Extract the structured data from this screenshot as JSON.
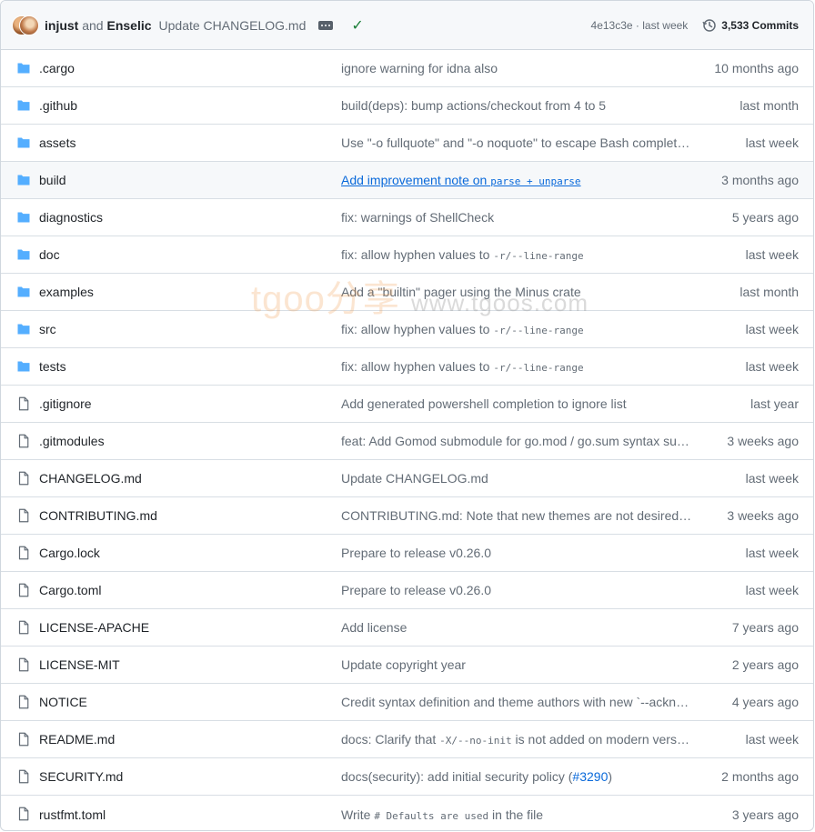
{
  "header": {
    "author1": "injust",
    "author_sep": "and",
    "author2": "Enselic",
    "commit_message": "Update CHANGELOG.md",
    "sha": "4e13c3e",
    "sha_sep": "·",
    "commit_age": "last week",
    "commits_count": "3,533 Commits"
  },
  "watermark": {
    "text": "tgoo分享",
    "url": "www.tgoos.com"
  },
  "colors": {
    "folder": "#54aeff",
    "file": "#636c76",
    "check": "#1a7f37",
    "link": "#0969da"
  },
  "files": [
    {
      "type": "folder",
      "name": ".cargo",
      "msg_parts": [
        {
          "t": "ignore warning for idna also"
        }
      ],
      "age": "10 months ago"
    },
    {
      "type": "folder",
      "name": ".github",
      "msg_parts": [
        {
          "t": "build(deps): bump actions/checkout from 4 to 5"
        }
      ],
      "age": "last month"
    },
    {
      "type": "folder",
      "name": "assets",
      "msg_parts": [
        {
          "t": "Use \"-o fullquote\" and \"-o noquote\" to escape Bash completion"
        }
      ],
      "age": "last week"
    },
    {
      "type": "folder",
      "name": "build",
      "link": true,
      "msg_parts": [
        {
          "t": "Add improvement note on "
        },
        {
          "code": "parse + unparse"
        }
      ],
      "age": "3 months ago"
    },
    {
      "type": "folder",
      "name": "diagnostics",
      "msg_parts": [
        {
          "t": "fix: warnings of ShellCheck"
        }
      ],
      "age": "5 years ago"
    },
    {
      "type": "folder",
      "name": "doc",
      "msg_parts": [
        {
          "t": "fix: allow hyphen values to "
        },
        {
          "code": "-r/--line-range"
        }
      ],
      "age": "last week"
    },
    {
      "type": "folder",
      "name": "examples",
      "msg_parts": [
        {
          "t": "Add a \"builtin\" pager using the Minus crate"
        }
      ],
      "age": "last month"
    },
    {
      "type": "folder",
      "name": "src",
      "msg_parts": [
        {
          "t": "fix: allow hyphen values to "
        },
        {
          "code": "-r/--line-range"
        }
      ],
      "age": "last week"
    },
    {
      "type": "folder",
      "name": "tests",
      "msg_parts": [
        {
          "t": "fix: allow hyphen values to "
        },
        {
          "code": "-r/--line-range"
        }
      ],
      "age": "last week"
    },
    {
      "type": "file",
      "name": ".gitignore",
      "msg_parts": [
        {
          "t": "Add generated powershell completion to ignore list"
        }
      ],
      "age": "last year"
    },
    {
      "type": "file",
      "name": ".gitmodules",
      "msg_parts": [
        {
          "t": "feat: Add Gomod submodule for go.mod / go.sum syntax support"
        }
      ],
      "age": "3 weeks ago"
    },
    {
      "type": "file",
      "name": "CHANGELOG.md",
      "msg_parts": [
        {
          "t": "Update CHANGELOG.md"
        }
      ],
      "age": "last week"
    },
    {
      "type": "file",
      "name": "CONTRIBUTING.md",
      "msg_parts": [
        {
          "t": "CONTRIBUTING.md: Note that new themes are not desired right now"
        }
      ],
      "age": "3 weeks ago"
    },
    {
      "type": "file",
      "name": "Cargo.lock",
      "msg_parts": [
        {
          "t": "Prepare to release v0.26.0"
        }
      ],
      "age": "last week"
    },
    {
      "type": "file",
      "name": "Cargo.toml",
      "msg_parts": [
        {
          "t": "Prepare to release v0.26.0"
        }
      ],
      "age": "last week"
    },
    {
      "type": "file",
      "name": "LICENSE-APACHE",
      "msg_parts": [
        {
          "t": "Add license"
        }
      ],
      "age": "7 years ago"
    },
    {
      "type": "file",
      "name": "LICENSE-MIT",
      "msg_parts": [
        {
          "t": "Update copyright year"
        }
      ],
      "age": "2 years ago"
    },
    {
      "type": "file",
      "name": "NOTICE",
      "msg_parts": [
        {
          "t": "Credit syntax definition and theme authors with new `--acknowledgements`"
        }
      ],
      "age": "4 years ago"
    },
    {
      "type": "file",
      "name": "README.md",
      "msg_parts": [
        {
          "t": "docs: Clarify that "
        },
        {
          "code": "-X/--no-init"
        },
        {
          "t": " is not added on modern versions"
        }
      ],
      "age": "last week"
    },
    {
      "type": "file",
      "name": "SECURITY.md",
      "msg_parts": [
        {
          "t": "docs(security): add initial security policy ("
        },
        {
          "ref": "#3290"
        },
        {
          "t": ")"
        }
      ],
      "age": "2 months ago"
    },
    {
      "type": "file",
      "name": "rustfmt.toml",
      "msg_parts": [
        {
          "t": "Write "
        },
        {
          "code": "# Defaults are used"
        },
        {
          "t": " in the file"
        }
      ],
      "age": "3 years ago"
    }
  ]
}
